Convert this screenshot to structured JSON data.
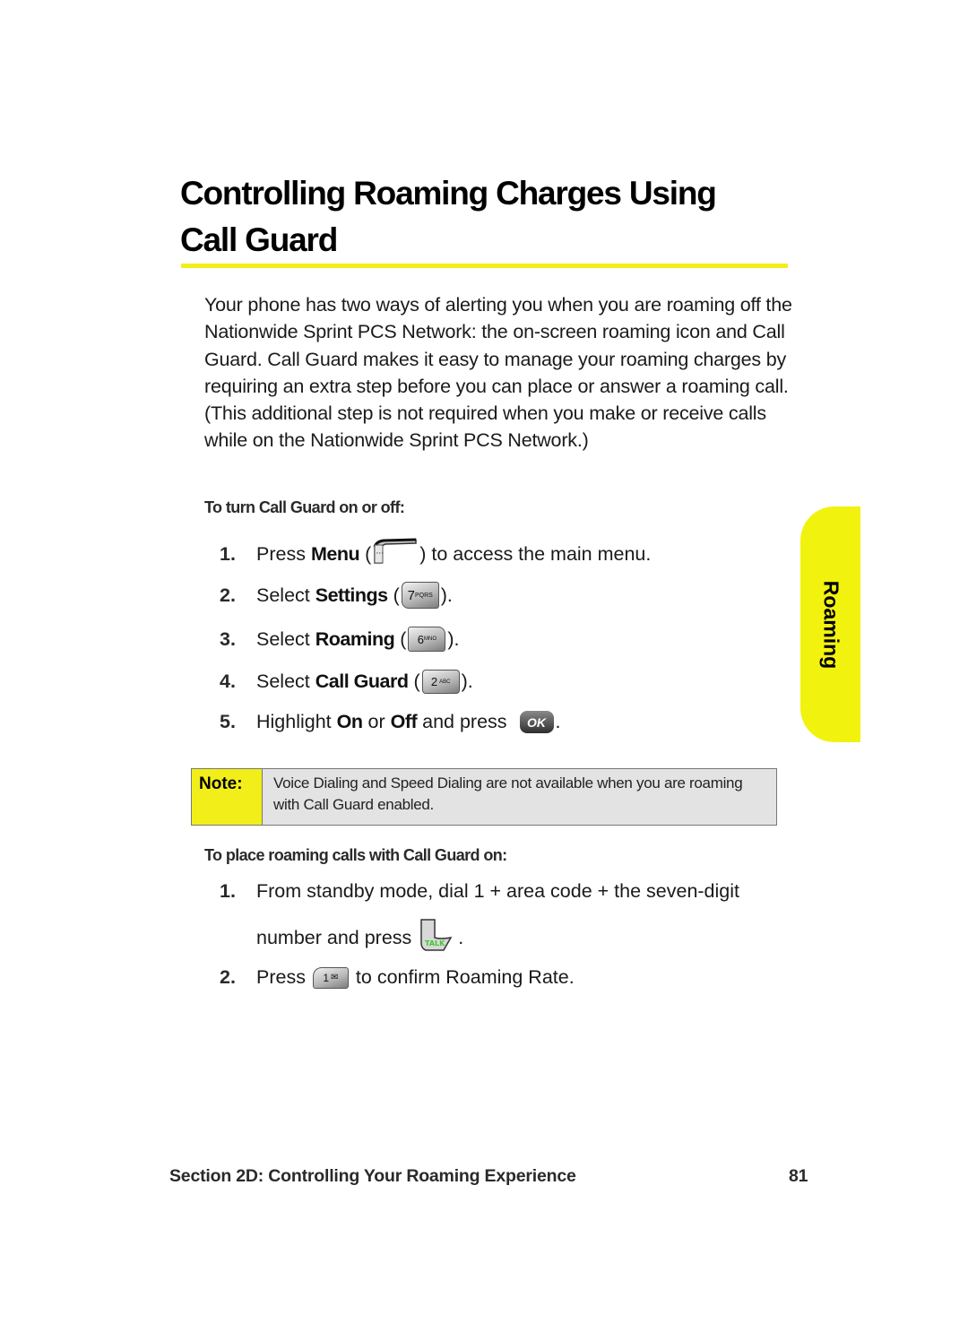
{
  "page": {
    "title_line1": "Controlling Roaming Charges Using",
    "title_line2": "Call Guard",
    "intro": "Your phone has two ways of alerting you when you are roaming off the Nationwide Sprint PCS Network: the on-screen roaming icon and Call Guard. Call Guard makes it easy to manage your roaming charges by requiring an extra step before you can place or answer a roaming call. (This additional step is not required when you make or receive calls while on the Nationwide Sprint PCS Network.)",
    "colors": {
      "accent_yellow": "#f2ee1a",
      "note_bg": "#e3e3e3"
    }
  },
  "section1": {
    "heading": "To turn Call Guard on or off:",
    "steps": [
      {
        "num": "1.",
        "pre": "Press ",
        "bold": "Menu",
        "mid": " (",
        "key": "menu-key-icon",
        "key_label": "···",
        "post": ") to access the main menu."
      },
      {
        "num": "2.",
        "pre": "Select ",
        "bold": "Settings",
        "mid": " (",
        "key": "key-7-icon",
        "key_label": "7PQRS",
        "post": ")."
      },
      {
        "num": "3.",
        "pre": "Select ",
        "bold": "Roaming",
        "mid": " (",
        "key": "key-6-icon",
        "key_label": "6MNO",
        "post": ")."
      },
      {
        "num": "4.",
        "pre": "Select ",
        "bold": "Call Guard",
        "mid": " (",
        "key": "key-2-icon",
        "key_label": "2ABC",
        "post": ")."
      },
      {
        "num": "5.",
        "pre": "Highlight ",
        "bold": "On",
        "mid2": " or ",
        "bold2": "Off",
        "post_a": " and press ",
        "key": "ok-key-icon",
        "key_label": "OK",
        "post": "."
      }
    ]
  },
  "note": {
    "label": "Note:",
    "text": "Voice Dialing and Speed Dialing are not available when you are roaming with Call Guard enabled."
  },
  "section2": {
    "heading": "To place roaming calls with Call Guard on:",
    "steps": [
      {
        "num": "1.",
        "line1": "From standby mode, dial 1 + area code + the seven-digit",
        "line2": "number and press ",
        "key": "talk-key-icon",
        "key_label": "TALK",
        "post": "."
      },
      {
        "num": "2.",
        "pre": "Press ",
        "key": "key-1-icon",
        "key_label": "1✉",
        "post": " to confirm Roaming Rate."
      }
    ]
  },
  "side_tab": {
    "label": "Roaming"
  },
  "footer": {
    "section": "Section 2D: Controlling Your Roaming Experience",
    "page_number": "81"
  }
}
